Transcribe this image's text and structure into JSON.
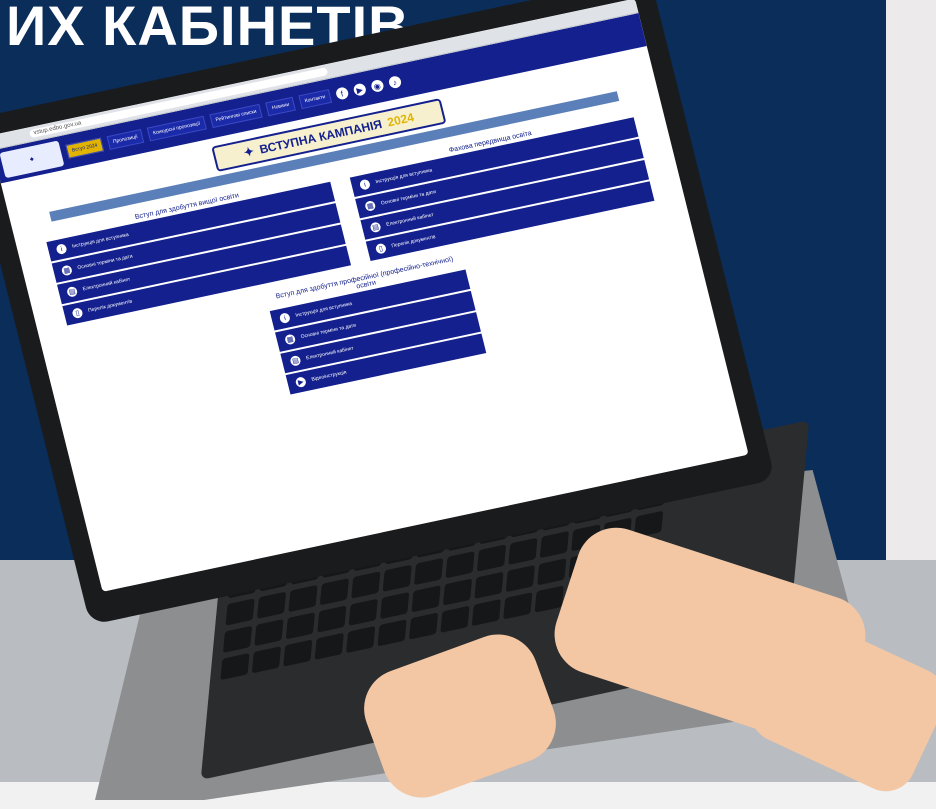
{
  "headline": "ИХ КАБІНЕТІВ",
  "laptop": {
    "browser": {
      "url": "vstup.edbo.gov.ua"
    },
    "site": {
      "nav_items": [
        "Вступ 2024",
        "Пропозиції",
        "Конкурсні пропозиції",
        "Рейтингові списки",
        "Новини",
        "Контакти"
      ],
      "campaign_title": "ВСТУПНА КАМПАНІЯ",
      "campaign_year": "2024",
      "section_higher": {
        "title": "Вступ для здобуття вищої освіти",
        "buttons": [
          "Інструкція для вступника",
          "Основні терміни та дати",
          "Електронний кабінет",
          "Перелік документів"
        ]
      },
      "section_prehigher": {
        "title": "Фахова передвища освіта",
        "buttons": [
          "Інструкція для вступника",
          "Основні терміни та дати",
          "Електронний кабінет",
          "Перелік документів"
        ]
      },
      "section_vocational": {
        "title": "Вступ для здобуття професійної (професійно-технічної) освіти",
        "buttons": [
          "Інструкція для вступника",
          "Основні терміни та дати",
          "Електронний кабінет",
          "Відеоінструкція"
        ]
      }
    }
  },
  "colors": {
    "background_navy": "#0a2d5a",
    "site_blue": "#13208e",
    "accent_gold": "#e0b400"
  }
}
